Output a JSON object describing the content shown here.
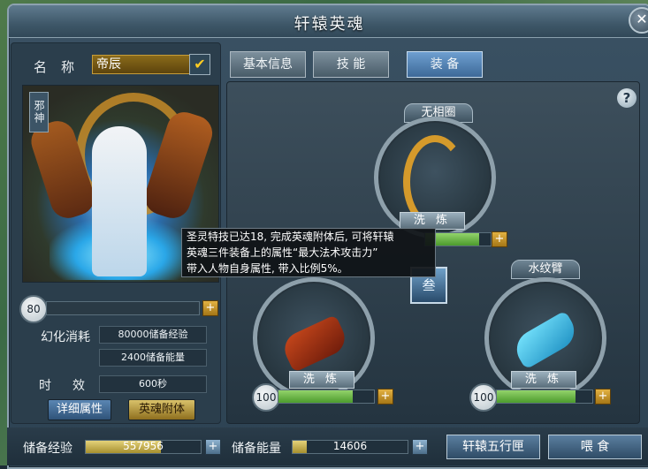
{
  "window": {
    "title": "轩辕英魂",
    "close_icon": "close-icon"
  },
  "left": {
    "name_label": "名称",
    "name_value": "帝辰",
    "badge": "邪神",
    "level": "80",
    "cost_label": "幻化消耗",
    "cost_exp": "80000储备经验",
    "cost_energy": "2400储备能量",
    "time_label": "时效",
    "time_value": "600秒",
    "details_button": "详细属性",
    "attach_button": "英魂附体"
  },
  "tabs": [
    {
      "label": "基本信息",
      "active": false
    },
    {
      "label": "技 能",
      "active": false
    },
    {
      "label": "装 备",
      "active": true
    }
  ],
  "equipment": {
    "slot_top": {
      "name": "无相圈",
      "wash": "洗 炼",
      "level": "",
      "progress": 0.82
    },
    "slot_left": {
      "name": "",
      "wash": "洗 炼",
      "level": "100",
      "progress": 0.78
    },
    "slot_right": {
      "name": "水纹臂",
      "wash": "洗 炼",
      "level": "100",
      "progress": 0.82
    },
    "center_emblem": "叁"
  },
  "tooltip": {
    "line1": "圣灵特技已达18, 完成英魂附体后, 可将轩辕",
    "line2": "英魂三件装备上的属性“最大法术攻击力”",
    "line3": "带入人物自身属性, 带入比例5%。"
  },
  "bottom": {
    "exp_label": "储备经验",
    "exp_value": "557956",
    "exp_progress": 0.65,
    "energy_label": "储备能量",
    "energy_value": "14606",
    "energy_progress": 0.12,
    "five_button": "轩辕五行匣",
    "feed_button": "喂 食"
  },
  "colors": {
    "accent_gold": "#d8b548",
    "accent_green": "#6fbf44",
    "panel": "#2d4252"
  }
}
